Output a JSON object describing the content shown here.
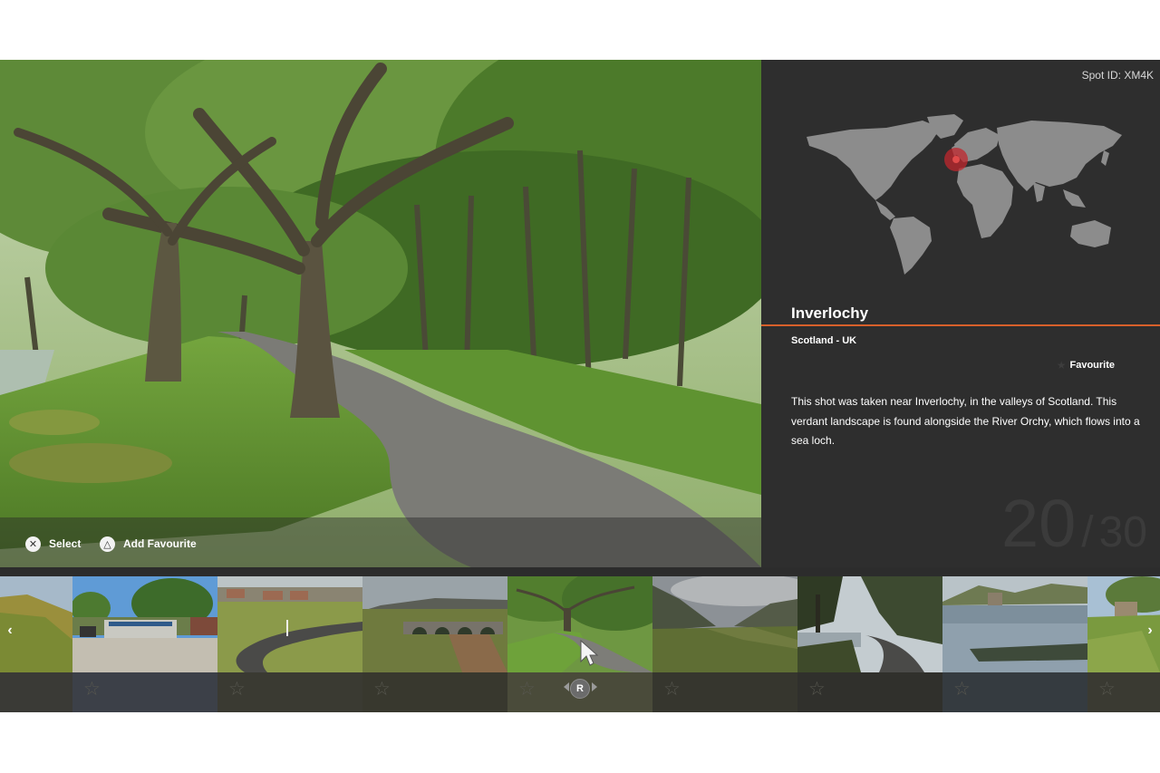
{
  "spot_id": "Spot ID: XM4K",
  "place": {
    "title": "Inverlochy",
    "region": "Scotland - UK",
    "favourite_label": "Favourite",
    "description": "This shot was taken near Inverlochy, in the valleys of Scotland. This verdant landscape is found alongside the River Orchy, which flows into a sea loch."
  },
  "counter": {
    "current": "20",
    "separator": "/",
    "total": "30"
  },
  "hints": [
    {
      "glyph": "✕",
      "label": "Select"
    },
    {
      "glyph": "△",
      "label": "Add Favourite"
    }
  ],
  "strip": {
    "prev_arrow": "‹",
    "next_arrow": "›",
    "r_badge": "R",
    "thumbnails": [
      {
        "name": "highland-hills",
        "favourite": false
      },
      {
        "name": "roadside-shop",
        "favourite": false
      },
      {
        "name": "moorland-road",
        "favourite": false
      },
      {
        "name": "stone-bridge",
        "favourite": false
      },
      {
        "name": "inverlochy",
        "favourite": false,
        "selected": true
      },
      {
        "name": "glen-valley",
        "favourite": false
      },
      {
        "name": "lochside-road",
        "favourite": false
      },
      {
        "name": "castle-loch",
        "favourite": false
      },
      {
        "name": "castle-hill",
        "favourite": false
      }
    ]
  },
  "colors": {
    "accent": "#d7602b",
    "panel": "#2e2e2e",
    "marker": "#c0272d"
  }
}
